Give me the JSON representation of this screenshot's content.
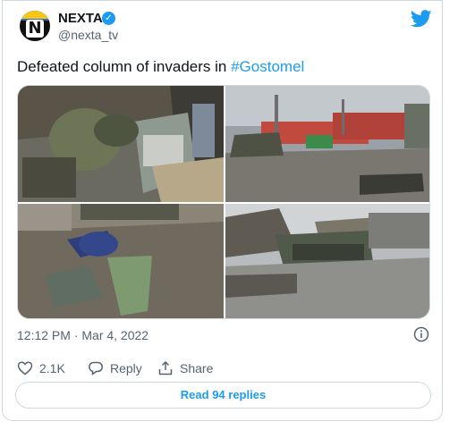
{
  "tweet": {
    "author_name": "NEXTA",
    "author_handle": "@nexta_tv",
    "avatar_letter": "N",
    "text_plain": "Defeated column of invaders in ",
    "hashtag": "#Gostomel",
    "timestamp": "12:12 PM · Mar 4, 2022",
    "likes": "2.1K",
    "reply_label": "Reply",
    "share_label": "Share",
    "read_replies_label": "Read 94 replies"
  },
  "colors": {
    "accent": "#1d9bf0",
    "muted": "#536471",
    "border": "#cfd9de"
  },
  "icons": [
    "twitter-bird-icon",
    "verified-badge-icon",
    "info-icon",
    "heart-icon",
    "reply-icon",
    "share-icon"
  ]
}
